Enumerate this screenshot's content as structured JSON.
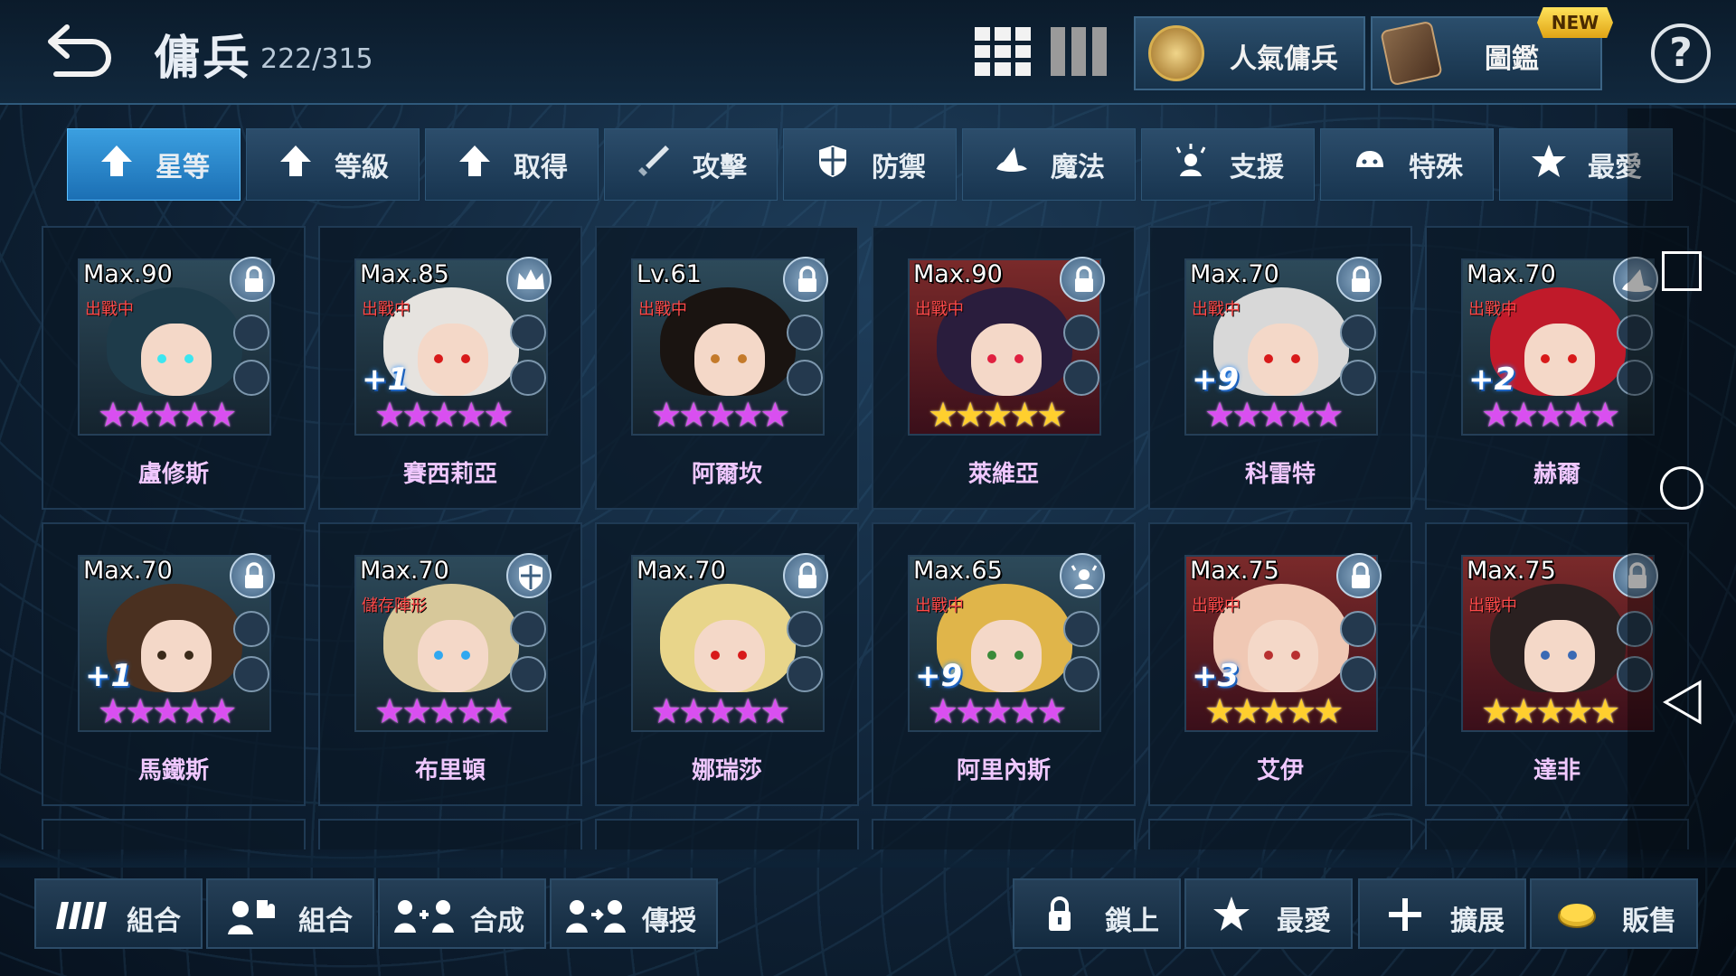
{
  "header": {
    "title": "傭兵",
    "count": "222/315",
    "popular_label": "人氣傭兵",
    "codex_label": "圖鑑",
    "new_badge": "NEW",
    "help": "?"
  },
  "sort_tabs": [
    {
      "label": "星等",
      "icon": "arrow-up-icon",
      "active": true
    },
    {
      "label": "等級",
      "icon": "arrow-up-icon",
      "active": false
    },
    {
      "label": "取得",
      "icon": "arrow-up-icon",
      "active": false
    },
    {
      "label": "攻擊",
      "icon": "sword-icon",
      "active": false
    },
    {
      "label": "防禦",
      "icon": "shield-icon",
      "active": false
    },
    {
      "label": "魔法",
      "icon": "magic-hat-icon",
      "active": false
    },
    {
      "label": "支援",
      "icon": "support-icon",
      "active": false
    },
    {
      "label": "特殊",
      "icon": "special-icon",
      "active": false
    },
    {
      "label": "最愛",
      "icon": "star-icon",
      "active": false
    }
  ],
  "mercenaries": [
    {
      "level": "Max.90",
      "status": "出戰中",
      "plus": "",
      "stars": 5,
      "star_color": "purple",
      "name": "盧修斯",
      "badge": "lock-icon",
      "hair": "#1e3b4a",
      "eye": "#3ce6f0"
    },
    {
      "level": "Max.85",
      "status": "出戰中",
      "plus": "+1",
      "stars": 5,
      "star_color": "purple",
      "name": "賽西莉亞",
      "badge": "crown-icon",
      "hair": "#e6e3df",
      "eye": "#d81a1a"
    },
    {
      "level": "Lv.61",
      "status": "出戰中",
      "plus": "",
      "stars": 5,
      "star_color": "purple",
      "name": "阿爾坎",
      "badge": "lock-icon",
      "hair": "#1a1411",
      "eye": "#c47a2a"
    },
    {
      "level": "Max.90",
      "status": "出戰中",
      "plus": "",
      "stars": 5,
      "star_color": "gold",
      "name": "萊維亞",
      "badge": "lock-icon",
      "hair": "#2a1d3d",
      "eye": "#e02040"
    },
    {
      "level": "Max.70",
      "status": "出戰中",
      "plus": "+9",
      "stars": 5,
      "star_color": "purple",
      "name": "科雷特",
      "badge": "lock-icon",
      "hair": "#d8d8d8",
      "eye": "#d81a1a"
    },
    {
      "level": "Max.70",
      "status": "出戰中",
      "plus": "+2",
      "stars": 5,
      "star_color": "purple",
      "name": "赫爾",
      "badge": "magic-hat-icon",
      "hair": "#c01a2a",
      "eye": "#d81a1a"
    },
    {
      "level": "Max.70",
      "status": "",
      "plus": "+1",
      "stars": 5,
      "star_color": "purple",
      "name": "馬鐵斯",
      "badge": "lock-icon",
      "hair": "#4a3020",
      "eye": "#3a2a1a"
    },
    {
      "level": "Max.70",
      "status": "儲存陣形",
      "plus": "",
      "stars": 5,
      "star_color": "purple",
      "name": "布里頓",
      "badge": "shield-icon",
      "hair": "#d7c89a",
      "eye": "#30a8f0"
    },
    {
      "level": "Max.70",
      "status": "",
      "plus": "",
      "stars": 5,
      "star_color": "purple",
      "name": "娜瑞莎",
      "badge": "lock-icon",
      "hair": "#e8d58a",
      "eye": "#d81a1a"
    },
    {
      "level": "Max.65",
      "status": "出戰中",
      "plus": "+9",
      "stars": 5,
      "star_color": "purple",
      "name": "阿里內斯",
      "badge": "support-icon",
      "hair": "#e0b54a",
      "eye": "#3a8a3a"
    },
    {
      "level": "Max.75",
      "status": "出戰中",
      "plus": "+3",
      "stars": 5,
      "star_color": "gold",
      "name": "艾伊",
      "badge": "lock-icon",
      "hair": "#f0c8b4",
      "eye": "#b83030"
    },
    {
      "level": "Max.75",
      "status": "出戰中",
      "plus": "",
      "stars": 5,
      "star_color": "gold",
      "name": "達非",
      "badge": "lock-icon",
      "hair": "#2a2020",
      "eye": "#3a6ab4"
    }
  ],
  "bottom_buttons": [
    {
      "label": "組合",
      "icon": "team-icon"
    },
    {
      "label": "組合",
      "icon": "puzzle-team-icon"
    },
    {
      "label": "合成",
      "icon": "fusion-icon"
    },
    {
      "label": "傳授",
      "icon": "transfer-icon"
    },
    {
      "label": "鎖上",
      "icon": "lock-icon"
    },
    {
      "label": "最愛",
      "icon": "star-icon"
    },
    {
      "label": "擴展",
      "icon": "plus-icon"
    },
    {
      "label": "販售",
      "icon": "gold-coin-icon"
    }
  ]
}
